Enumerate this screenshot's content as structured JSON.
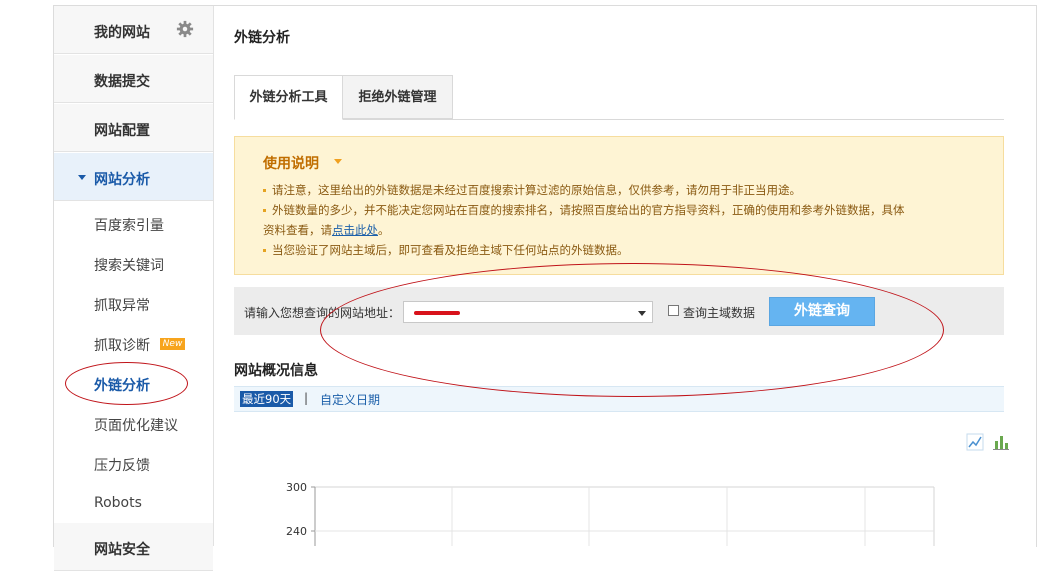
{
  "sidebar": {
    "top_items": [
      {
        "label": "我的网站"
      },
      {
        "label": "数据提交"
      },
      {
        "label": "网站配置"
      },
      {
        "label": "网站分析"
      }
    ],
    "sub_items": [
      {
        "label": "百度索引量"
      },
      {
        "label": "搜索关键词"
      },
      {
        "label": "抓取异常"
      },
      {
        "label": "抓取诊断",
        "badge": "New"
      },
      {
        "label": "外链分析"
      },
      {
        "label": "页面优化建议"
      },
      {
        "label": "压力反馈"
      },
      {
        "label": "Robots"
      }
    ],
    "bottom_item": "网站安全"
  },
  "main": {
    "title": "外链分析",
    "tabs": [
      {
        "label": "外链分析工具"
      },
      {
        "label": "拒绝外链管理"
      }
    ],
    "notice": {
      "title": "使用说明",
      "line1": "请注意，这里给出的外链数据是未经过百度搜索计算过滤的原始信息，仅供参考，请勿用于非正当用途。",
      "line2a": "外链数量的多少，并不能决定您网站在百度的搜索排名，请按照百度给出的官方指导资料，正确的使用和参考外链数据，具体",
      "line2b_pre": "资料查看，请",
      "line2b_link": "点击此处",
      "line2b_post": "。",
      "line3": "当您验证了网站主域后，即可查看及拒绝主域下任何站点的外链数据。"
    },
    "query": {
      "label": "请输入您想查询的网站地址：",
      "checkbox_label": "查询主域数据",
      "button": "外链查询"
    },
    "overview": {
      "title": "网站概况信息",
      "date_selected": "最近90天",
      "date_separator": "|",
      "date_custom": "自定义日期"
    }
  },
  "chart_data": {
    "type": "line",
    "y_ticks": [
      "300",
      "240"
    ],
    "ylim": [
      240,
      300
    ]
  },
  "colors": {
    "accent": "#1a5aa8",
    "notice_bg": "#fef4d4",
    "button": "#65b4f1",
    "annotation": "#c0141a"
  }
}
